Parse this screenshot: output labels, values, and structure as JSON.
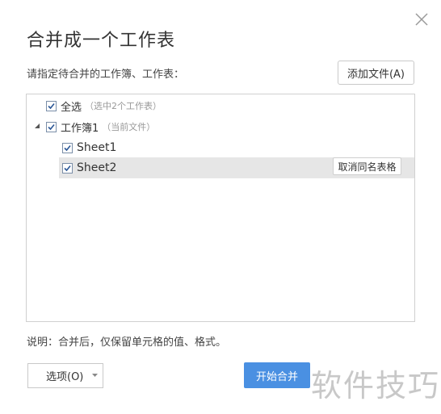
{
  "dialog": {
    "title": "合并成一个工作表",
    "subtitle": "请指定待合并的工作簿、工作表：",
    "add_file_label": "添加文件(A)",
    "tree": {
      "select_all": {
        "label": "全选",
        "note": "（选中2个工作表）",
        "checked": true
      },
      "workbook": {
        "label": "工作簿1",
        "note": "（当前文件）",
        "checked": true,
        "expanded": true
      },
      "sheets": [
        {
          "label": "Sheet1",
          "checked": true,
          "selected": false
        },
        {
          "label": "Sheet2",
          "checked": true,
          "selected": true
        }
      ],
      "cancel_same_name_label": "取消同名表格"
    },
    "note": "说明：合并后，仅保留单元格的值、格式。",
    "options_label": "选项(O)",
    "start_label": "开始合并"
  },
  "watermark": "软件技巧",
  "colors": {
    "primary_button": "#4a90e2",
    "selected_row": "#e6e6e6",
    "border": "#d0d0d0"
  },
  "icons": {
    "close": "close-icon",
    "expand": "triangle-expanded-icon",
    "checkbox": "checkmark-icon",
    "dropdown": "chevron-down-icon"
  }
}
